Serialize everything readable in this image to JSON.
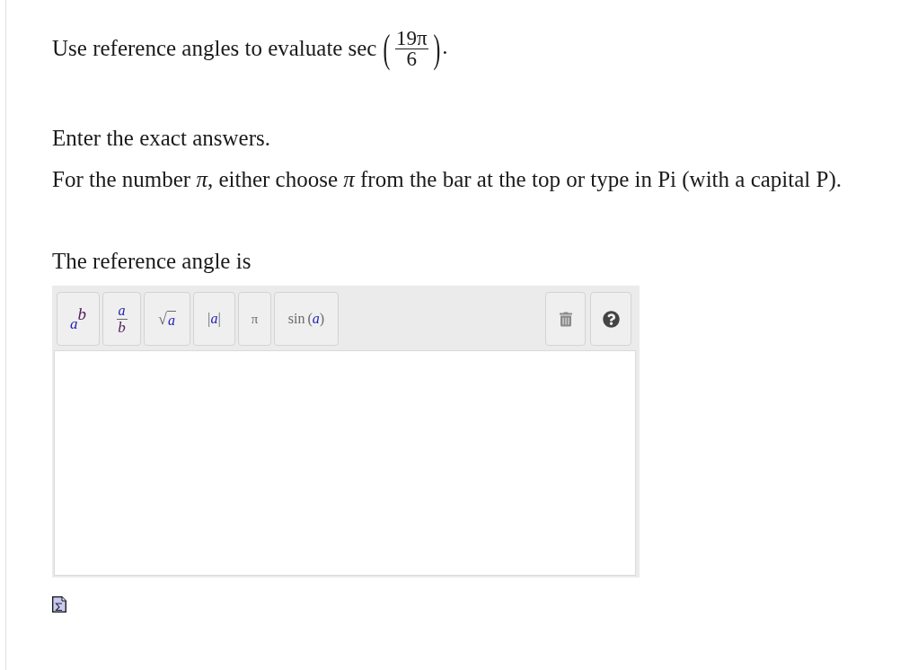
{
  "question": {
    "intro": "Use reference angles to evaluate",
    "function": "sec",
    "open_paren": "(",
    "fraction": {
      "numerator": "19π",
      "denominator": "6"
    },
    "close_paren": ")",
    "period": "."
  },
  "instructions": [
    "Enter the exact answers.",
    "For the number *π*, either choose *π* from the bar at the top or type in Pi (with a capital P)."
  ],
  "prompt": "The reference angle is",
  "toolbar": {
    "buttons": [
      {
        "kind": "power",
        "base": "a",
        "exponent": "b"
      },
      {
        "kind": "fraction",
        "numerator": "a",
        "denominator": "b"
      },
      {
        "kind": "sqrt",
        "radical": "√",
        "radicand": "a"
      },
      {
        "kind": "abs",
        "left_bar": "|",
        "argument": "a",
        "right_bar": "|"
      },
      {
        "kind": "symbol",
        "label": "π"
      },
      {
        "kind": "function",
        "name": "sin",
        "open": "(",
        "argument": "a",
        "close": ")"
      }
    ]
  }
}
